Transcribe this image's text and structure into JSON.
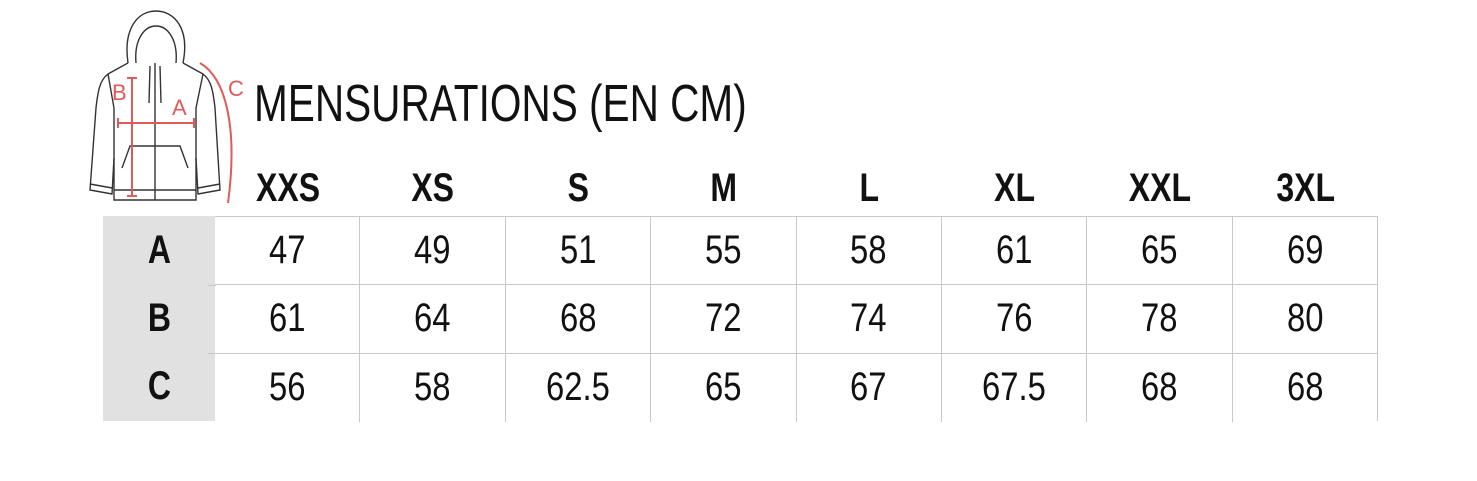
{
  "title": "MENSURATIONS (EN CM)",
  "diagram": {
    "label_a": "A",
    "label_b": "B",
    "label_c": "C",
    "accent_color": "#e05a5a"
  },
  "table": {
    "sizes": [
      "XXS",
      "XS",
      "S",
      "M",
      "L",
      "XL",
      "XXL",
      "3XL"
    ],
    "rows": [
      {
        "label": "A",
        "values": [
          "47",
          "49",
          "51",
          "55",
          "58",
          "61",
          "65",
          "69"
        ]
      },
      {
        "label": "B",
        "values": [
          "61",
          "64",
          "68",
          "72",
          "74",
          "76",
          "78",
          "80"
        ]
      },
      {
        "label": "C",
        "values": [
          "56",
          "58",
          "62.5",
          "65",
          "67",
          "67.5",
          "68",
          "68"
        ]
      }
    ]
  }
}
